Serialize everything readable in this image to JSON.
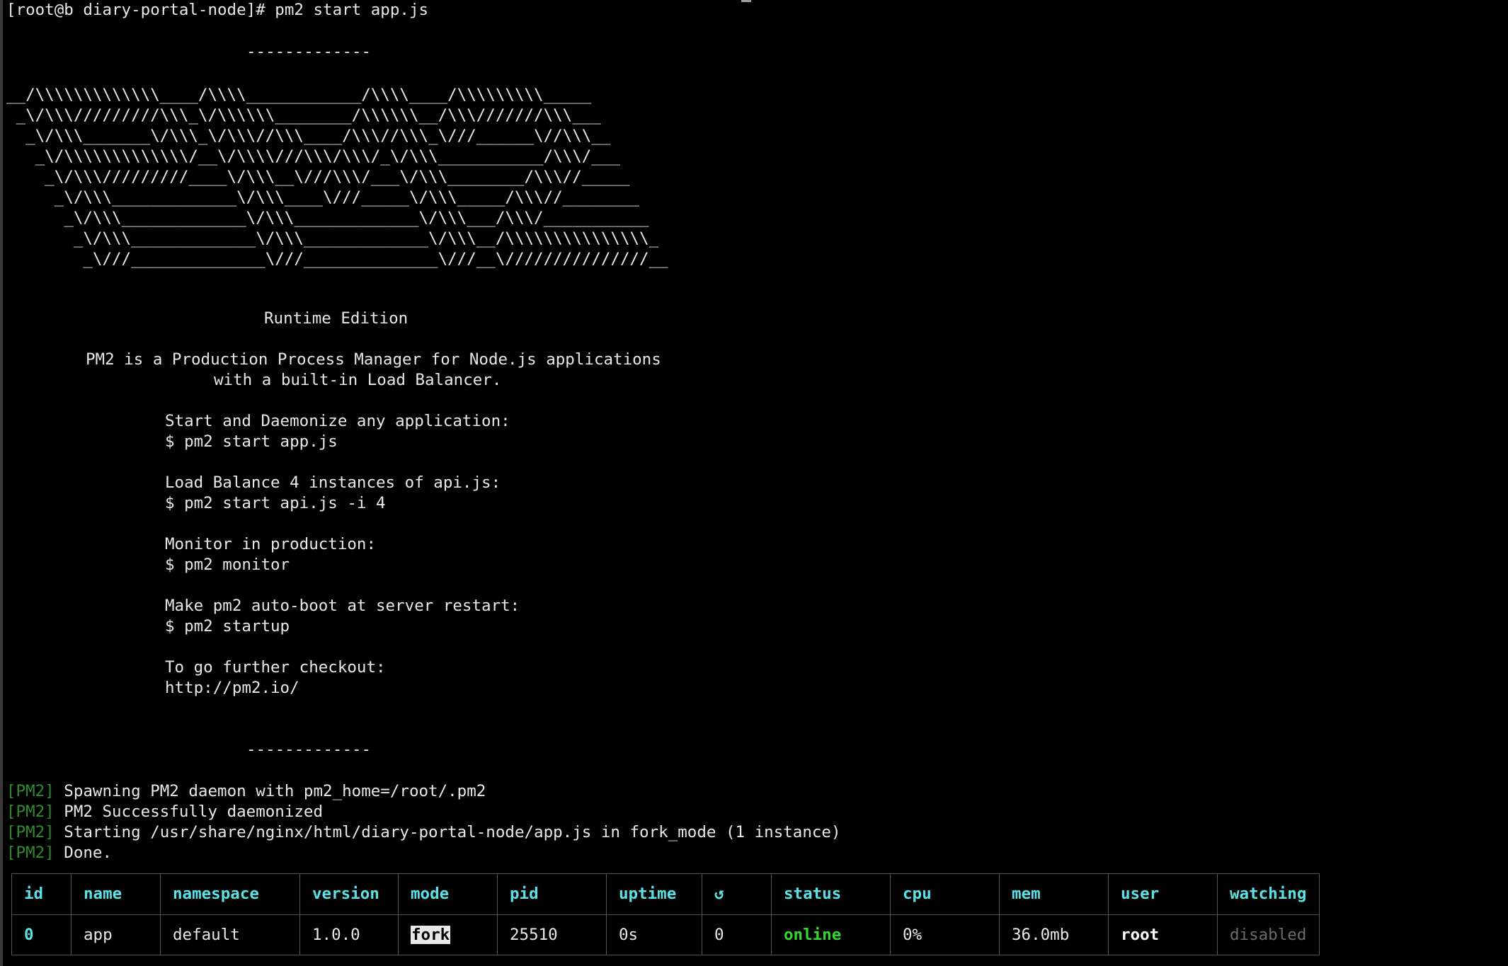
{
  "prompt": "[root@b diary-portal-node]# pm2 start app.js",
  "banner": {
    "dashes_top": "-------------",
    "ascii_art": [
      "__/\\\\\\\\\\\\\\\\\\\\\\\\\\____/\\\\\\\\____________/\\\\\\\\____/\\\\\\\\\\\\\\\\\\_____",
      " _\\/\\\\\\/////////\\\\\\_\\/\\\\\\\\\\\\________/\\\\\\\\\\\\__/\\\\\\///////\\\\\\___",
      "  _\\/\\\\\\_______\\/\\\\\\_\\/\\\\\\//\\\\\\____/\\\\\\//\\\\\\_\\///______\\//\\\\\\__",
      "   _\\/\\\\\\\\\\\\\\\\\\\\\\\\\\/__\\/\\\\\\\\///\\\\\\/\\\\\\/_\\/\\\\\\___________/\\\\\\/___",
      "    _\\/\\\\\\/////////____\\/\\\\\\__\\///\\\\\\/___\\/\\\\\\________/\\\\\\//_____",
      "     _\\/\\\\\\_____________\\/\\\\\\____\\///_____\\/\\\\\\_____/\\\\\\//________",
      "      _\\/\\\\\\_____________\\/\\\\\\_____________\\/\\\\\\___/\\\\\\/___________",
      "       _\\/\\\\\\_____________\\/\\\\\\_____________\\/\\\\\\__/\\\\\\\\\\\\\\\\\\\\\\\\\\\\\\_",
      "        _\\///______________\\///______________\\///__\\///////////////__"
    ],
    "edition": "Runtime Edition",
    "desc_1": "PM2 is a Production Process Manager for Node.js applications",
    "desc_2": "with a built-in Load Balancer.",
    "tips": [
      {
        "label": "Start and Daemonize any application:",
        "cmd": "$ pm2 start app.js"
      },
      {
        "label": "Load Balance 4 instances of api.js:",
        "cmd": "$ pm2 start api.js -i 4"
      },
      {
        "label": "Monitor in production:",
        "cmd": "$ pm2 monitor"
      },
      {
        "label": "Make pm2 auto-boot at server restart:",
        "cmd": "$ pm2 startup"
      },
      {
        "label": "To go further checkout:",
        "cmd": "http://pm2.io/"
      }
    ],
    "dashes_bottom": "-------------"
  },
  "log": {
    "tag": "[PM2]",
    "lines": [
      "Spawning PM2 daemon with pm2_home=/root/.pm2",
      "PM2 Successfully daemonized",
      "Starting /usr/share/nginx/html/diary-portal-node/app.js in fork_mode (1 instance)",
      "Done."
    ]
  },
  "table": {
    "headers": [
      "id",
      "name",
      "namespace",
      "version",
      "mode",
      "pid",
      "uptime",
      "↺",
      "status",
      "cpu",
      "mem",
      "user",
      "watching"
    ],
    "row": [
      "0",
      "app",
      "default",
      "1.0.0",
      "fork",
      "25510",
      "0s",
      "0",
      "online",
      "0%",
      "36.0mb",
      "root",
      "disabled"
    ]
  },
  "colors": {
    "background": "#000000",
    "text": "#e8e8e8",
    "header": "#5ce1e6",
    "online": "#34d634",
    "pm2_tag": "#2e8b2e",
    "dim": "#6b6b6b"
  }
}
